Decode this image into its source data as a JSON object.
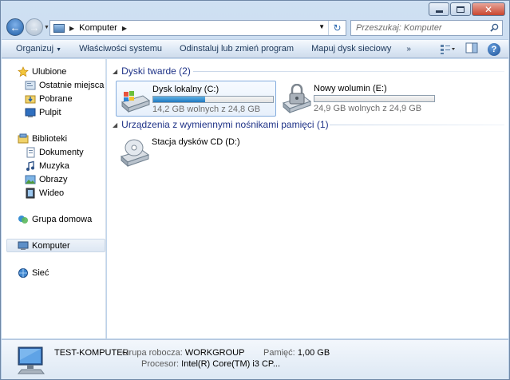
{
  "window": {
    "caption_buttons": [
      "minimize",
      "maximize",
      "close"
    ]
  },
  "address_bar": {
    "path": [
      "Komputer"
    ],
    "folder_icon": "computer-icon"
  },
  "search": {
    "placeholder": "Przeszukaj: Komputer"
  },
  "toolbar": {
    "items": [
      {
        "label": "Organizuj",
        "has_dropdown": true
      },
      {
        "label": "Właściwości systemu"
      },
      {
        "label": "Odinstaluj lub zmień program"
      },
      {
        "label": "Mapuj dysk sieciowy"
      }
    ],
    "more": "»"
  },
  "nav_pane": {
    "favorites": {
      "label": "Ulubione",
      "items": [
        "Ostatnie miejsca",
        "Pobrane",
        "Pulpit"
      ]
    },
    "libraries": {
      "label": "Biblioteki",
      "items": [
        "Dokumenty",
        "Muzyka",
        "Obrazy",
        "Wideo"
      ]
    },
    "homegroup": "Grupa domowa",
    "computer": "Komputer",
    "network": "Sieć"
  },
  "content": {
    "hard_drives_header": "Dyski twarde (2)",
    "removable_header": "Urządzenia z wymiennymi nośnikami pamięci (1)",
    "drives": [
      {
        "name": "Dysk lokalny (C:)",
        "info": "14,2 GB wolnych z 24,8 GB",
        "used_fraction": 0.43,
        "selected": true
      },
      {
        "name": "Nowy wolumin (E:)",
        "info": "24,9 GB wolnych z 24,9 GB",
        "used_fraction": 0.0,
        "selected": false
      }
    ],
    "removable": [
      {
        "name": "Stacja dysków CD (D:)"
      }
    ]
  },
  "details": {
    "computer_name": "TEST-KOMPUTER",
    "workgroup_label": "Grupa robocza:",
    "workgroup": "WORKGROUP",
    "memory_label": "Pamięć:",
    "memory": "1,00 GB",
    "processor_label": "Procesor:",
    "processor": "Intel(R) Core(TM) i3 CP..."
  },
  "colors": {
    "header_blue": "#1e3287",
    "toolbar_text": "#1e395b",
    "drive_bar_fill": "#1f78c1"
  }
}
